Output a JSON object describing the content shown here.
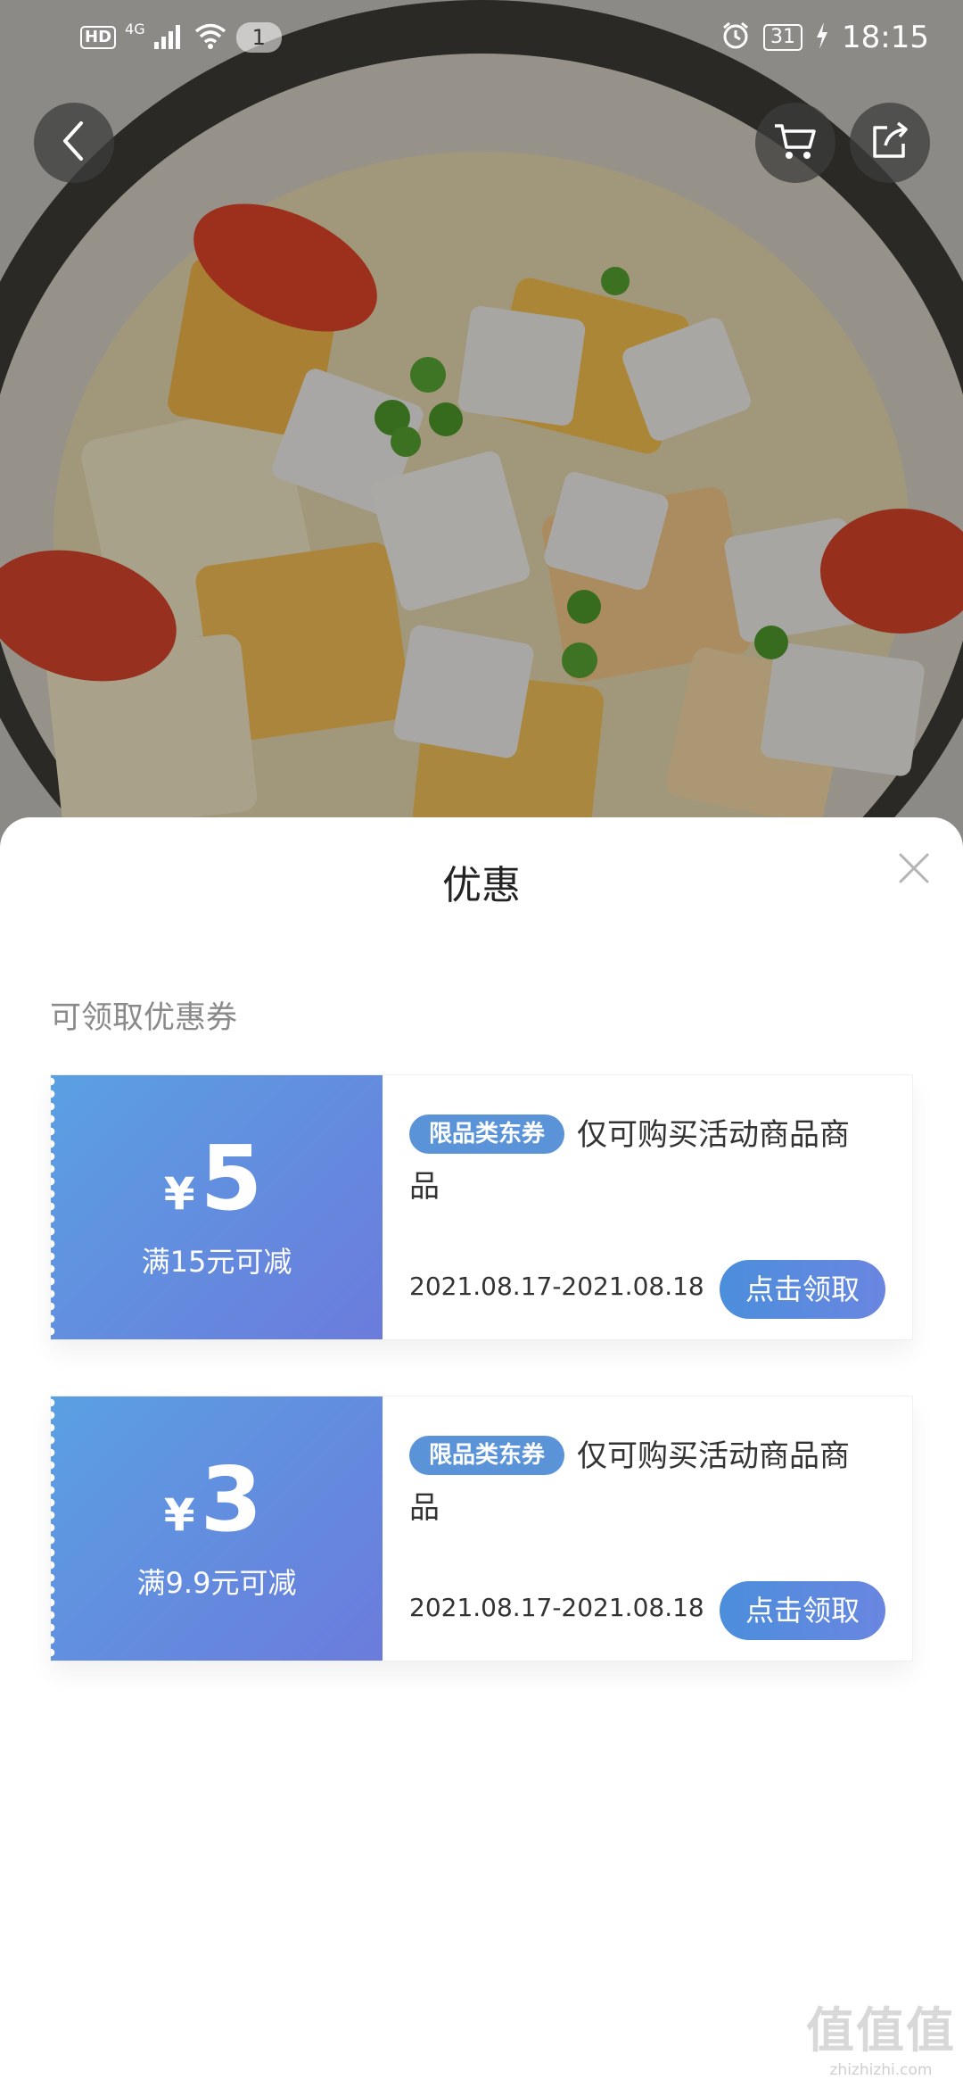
{
  "status_bar": {
    "hd": "HD",
    "network": "4G",
    "notification_count": "1",
    "battery": "31",
    "time": "18:15"
  },
  "top_actions": {
    "back_icon": "chevron-left-icon",
    "cart_icon": "cart-icon",
    "share_icon": "share-icon"
  },
  "sheet": {
    "title": "优惠",
    "section_label": "可领取优惠券",
    "coupons": [
      {
        "currency": "¥",
        "amount": "5",
        "condition": "满15元可减",
        "tag": "限品类东券",
        "description": "仅可购买活动商品商品",
        "validity": "2021.08.17-2021.08.18",
        "button": "点击领取"
      },
      {
        "currency": "¥",
        "amount": "3",
        "condition": "满9.9元可减",
        "tag": "限品类东券",
        "description": "仅可购买活动商品商品",
        "validity": "2021.08.17-2021.08.18",
        "button": "点击领取"
      }
    ]
  },
  "watermark": {
    "logo": "值值值",
    "url": "zhizhizhi.com"
  },
  "colors": {
    "coupon_gradient_start": "#5aa0e2",
    "coupon_gradient_end": "#6b7bdc",
    "tag_bg": "#5a93d8",
    "button_bg": "#4b8edc"
  }
}
